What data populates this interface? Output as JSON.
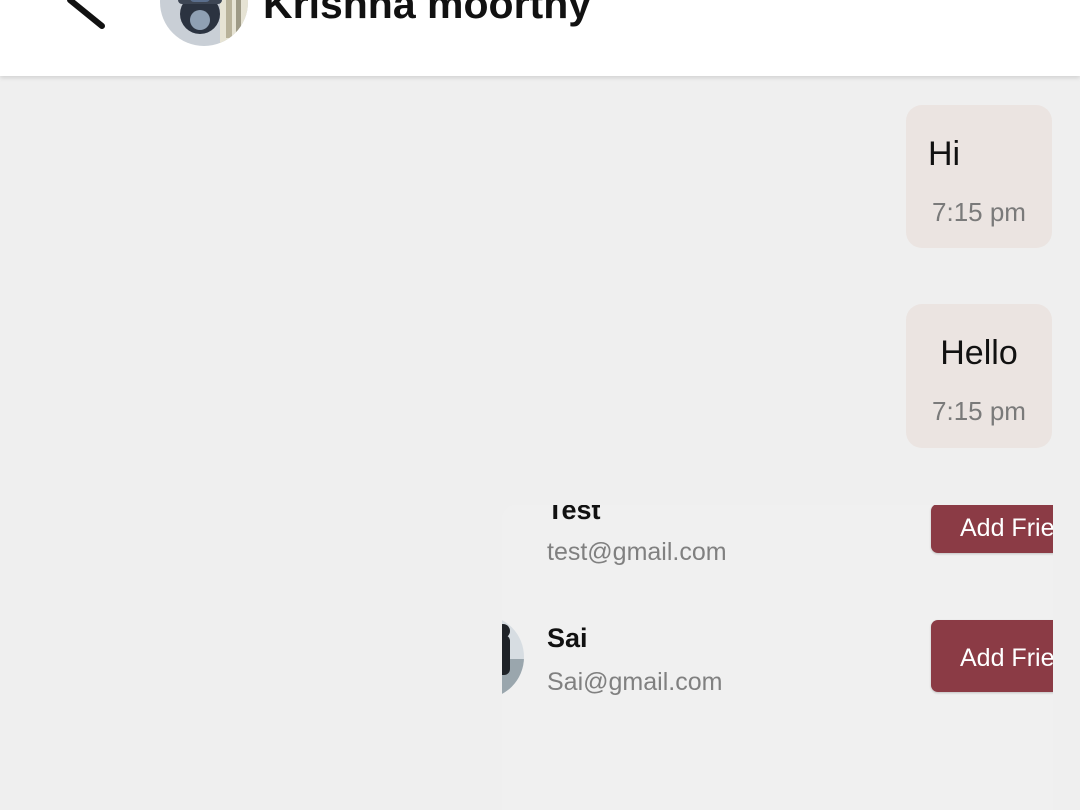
{
  "header": {
    "back_icon": "arrow-back-icon",
    "contact_name": "Krishna moorthy",
    "avatar_icon": "contact-avatar"
  },
  "messages": [
    {
      "text": "Hi",
      "time": "7:15 pm"
    },
    {
      "text": "Hello",
      "time": "7:15 pm"
    }
  ],
  "users": [
    {
      "name": "Test",
      "email": "test@gmail.com",
      "action": "Add Friend"
    },
    {
      "name": "Sai",
      "email": "Sai@gmail.com",
      "action": "Add Friend"
    }
  ],
  "colors": {
    "bubble": "#ebe4e1",
    "accent_button": "#8b3b45",
    "background": "#efefef"
  }
}
